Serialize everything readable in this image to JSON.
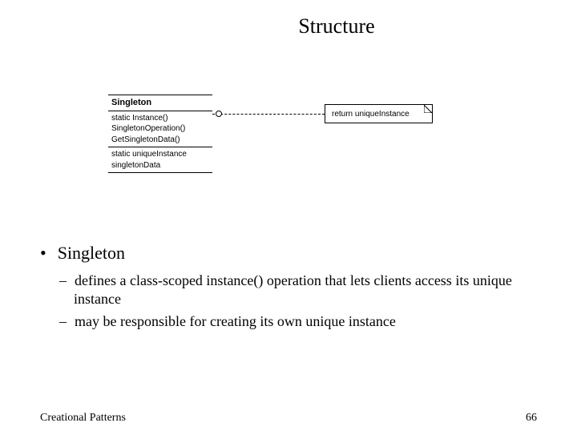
{
  "title": "Structure",
  "uml": {
    "class_name": "Singleton",
    "ops": {
      "line1": "static Instance()",
      "line2": "SingletonOperation()",
      "line3": "GetSingletonData()"
    },
    "attrs": {
      "line1": "static uniqueInstance",
      "line2": "singletonData"
    },
    "note": "return uniqueInstance"
  },
  "bullets": {
    "l1": "Singleton",
    "l2a": "defines a class-scoped instance() operation that lets clients access its unique instance",
    "l2b": "may be responsible for creating its own unique instance"
  },
  "footer": {
    "left": "Creational Patterns",
    "page": "66"
  }
}
